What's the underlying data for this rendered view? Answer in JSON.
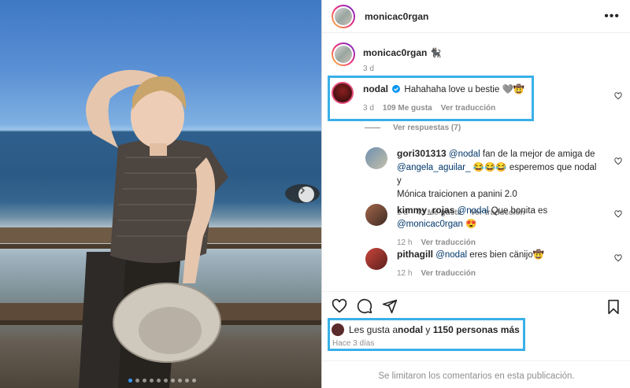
{
  "post": {
    "username": "monicac0rgan",
    "more_icon": "more-horizontal-icon",
    "caption_username": "monicac0rgan",
    "caption_text": "🐈‍⬛",
    "caption_time": "3 d",
    "carousel_dots": 10,
    "carousel_active": 1
  },
  "comments": [
    {
      "username": "nodal",
      "verified": true,
      "text": "Hahahaha love u bestie 🩶🤠",
      "time": "3 d",
      "likes": "109 Me gusta",
      "translate": "Ver traducción",
      "view_replies": "Ver respuestas (7)"
    },
    {
      "username": "gori301313",
      "mention1": "@nodal",
      "text1": " fan de la mejor de amiga de",
      "mention2": "@angela_aguilar_",
      "text2": " 😂😂😂 esperemos que nodal y",
      "text3": "Mónica traicionen a panini 2.0",
      "time": "1 d",
      "likes": "43 Me gusta",
      "translate": "Ver traducción"
    },
    {
      "username": "kimmy_rojas",
      "mention1": "@nodal",
      "text1": " Que bonita es",
      "mention2": "@monicac0rgan",
      "text2": " 😍",
      "time": "12 h",
      "translate": "Ver traducción"
    },
    {
      "username": "pithagill",
      "mention1": "@nodal",
      "text1": " eres bien cänijo🤠",
      "time": "12 h",
      "translate": "Ver traducción"
    }
  ],
  "likes_bar": {
    "prefix": "Les gusta a ",
    "user": "nodal",
    "joiner": " y ",
    "others": "1150 personas más",
    "ago": "Hace 3 días"
  },
  "footer": {
    "limited": "Se limitaron los comentarios en esta publicación."
  },
  "colors": {
    "highlight": "#3ab0e8",
    "mention": "#00376b",
    "muted": "#8e8e8e"
  }
}
